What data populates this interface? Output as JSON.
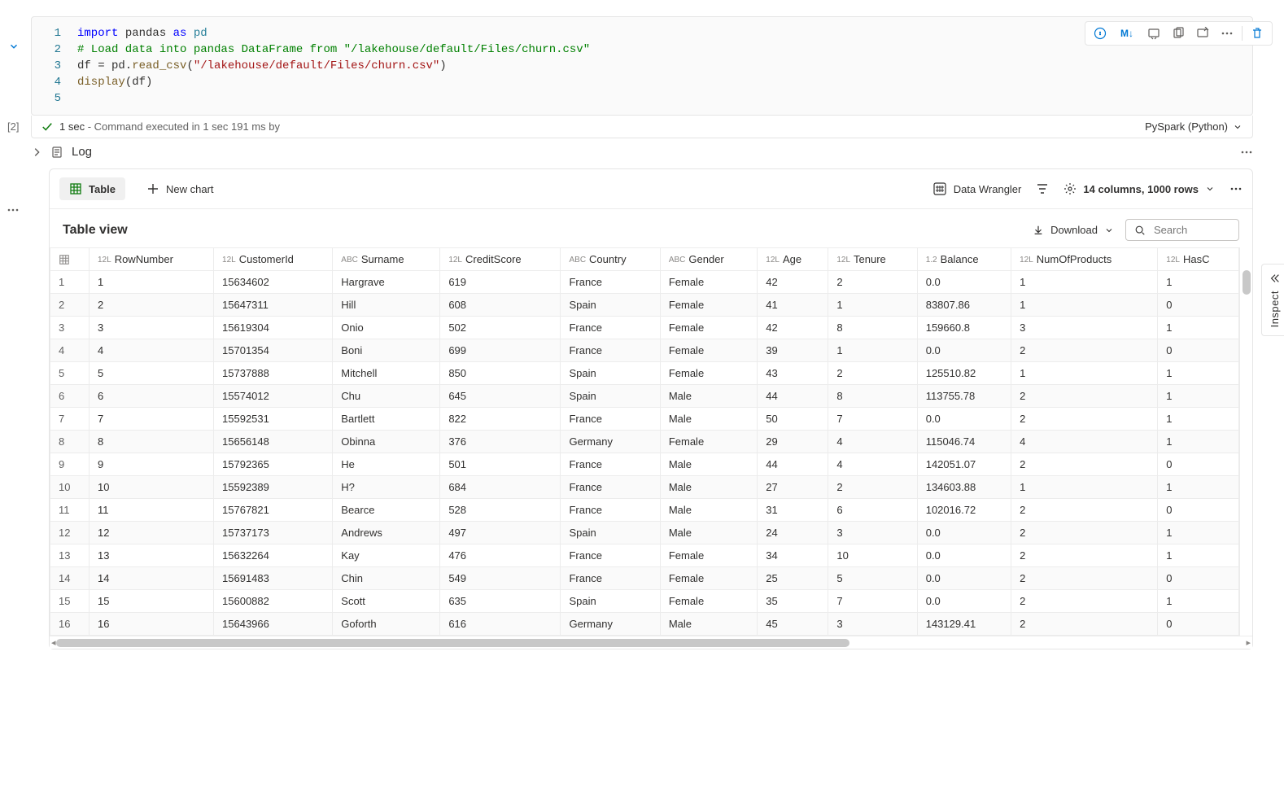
{
  "cell": {
    "exec_label": "[2]",
    "gutter": [
      "1",
      "2",
      "3",
      "4",
      "5"
    ],
    "status_time": "1 sec",
    "status_detail": " - Command executed in 1 sec 191 ms by",
    "language": "PySpark (Python)"
  },
  "code": {
    "l1a": "import",
    "l1b": " pandas ",
    "l1c": "as",
    "l1d": " pd",
    "l2": "# Load data into pandas DataFrame from \"/lakehouse/default/Files/churn.csv\"",
    "l3a": "df = pd.",
    "l3b": "read_csv",
    "l3c": "(",
    "l3d": "\"/lakehouse/default/Files/churn.csv\"",
    "l3e": ")",
    "l4a": "display",
    "l4b": "(df)"
  },
  "log": {
    "label": "Log"
  },
  "output": {
    "tab_table": "Table",
    "tab_newchart": "New chart",
    "data_wrangler": "Data Wrangler",
    "columns_summary": "14 columns, 1000 rows",
    "table_view": "Table view",
    "download": "Download",
    "search_placeholder": "Search"
  },
  "inspect": {
    "label": "Inspect"
  },
  "columns": [
    {
      "type": "12L",
      "name": "RowNumber"
    },
    {
      "type": "12L",
      "name": "CustomerId"
    },
    {
      "type": "ABC",
      "name": "Surname"
    },
    {
      "type": "12L",
      "name": "CreditScore"
    },
    {
      "type": "ABC",
      "name": "Country"
    },
    {
      "type": "ABC",
      "name": "Gender"
    },
    {
      "type": "12L",
      "name": "Age"
    },
    {
      "type": "12L",
      "name": "Tenure"
    },
    {
      "type": "1.2",
      "name": "Balance"
    },
    {
      "type": "12L",
      "name": "NumOfProducts"
    },
    {
      "type": "12L",
      "name": "HasC"
    }
  ],
  "rows": [
    [
      "1",
      "1",
      "15634602",
      "Hargrave",
      "619",
      "France",
      "Female",
      "42",
      "2",
      "0.0",
      "1",
      "1"
    ],
    [
      "2",
      "2",
      "15647311",
      "Hill",
      "608",
      "Spain",
      "Female",
      "41",
      "1",
      "83807.86",
      "1",
      "0"
    ],
    [
      "3",
      "3",
      "15619304",
      "Onio",
      "502",
      "France",
      "Female",
      "42",
      "8",
      "159660.8",
      "3",
      "1"
    ],
    [
      "4",
      "4",
      "15701354",
      "Boni",
      "699",
      "France",
      "Female",
      "39",
      "1",
      "0.0",
      "2",
      "0"
    ],
    [
      "5",
      "5",
      "15737888",
      "Mitchell",
      "850",
      "Spain",
      "Female",
      "43",
      "2",
      "125510.82",
      "1",
      "1"
    ],
    [
      "6",
      "6",
      "15574012",
      "Chu",
      "645",
      "Spain",
      "Male",
      "44",
      "8",
      "113755.78",
      "2",
      "1"
    ],
    [
      "7",
      "7",
      "15592531",
      "Bartlett",
      "822",
      "France",
      "Male",
      "50",
      "7",
      "0.0",
      "2",
      "1"
    ],
    [
      "8",
      "8",
      "15656148",
      "Obinna",
      "376",
      "Germany",
      "Female",
      "29",
      "4",
      "115046.74",
      "4",
      "1"
    ],
    [
      "9",
      "9",
      "15792365",
      "He",
      "501",
      "France",
      "Male",
      "44",
      "4",
      "142051.07",
      "2",
      "0"
    ],
    [
      "10",
      "10",
      "15592389",
      "H?",
      "684",
      "France",
      "Male",
      "27",
      "2",
      "134603.88",
      "1",
      "1"
    ],
    [
      "11",
      "11",
      "15767821",
      "Bearce",
      "528",
      "France",
      "Male",
      "31",
      "6",
      "102016.72",
      "2",
      "0"
    ],
    [
      "12",
      "12",
      "15737173",
      "Andrews",
      "497",
      "Spain",
      "Male",
      "24",
      "3",
      "0.0",
      "2",
      "1"
    ],
    [
      "13",
      "13",
      "15632264",
      "Kay",
      "476",
      "France",
      "Female",
      "34",
      "10",
      "0.0",
      "2",
      "1"
    ],
    [
      "14",
      "14",
      "15691483",
      "Chin",
      "549",
      "France",
      "Female",
      "25",
      "5",
      "0.0",
      "2",
      "0"
    ],
    [
      "15",
      "15",
      "15600882",
      "Scott",
      "635",
      "Spain",
      "Female",
      "35",
      "7",
      "0.0",
      "2",
      "1"
    ],
    [
      "16",
      "16",
      "15643966",
      "Goforth",
      "616",
      "Germany",
      "Male",
      "45",
      "3",
      "143129.41",
      "2",
      "0"
    ]
  ]
}
